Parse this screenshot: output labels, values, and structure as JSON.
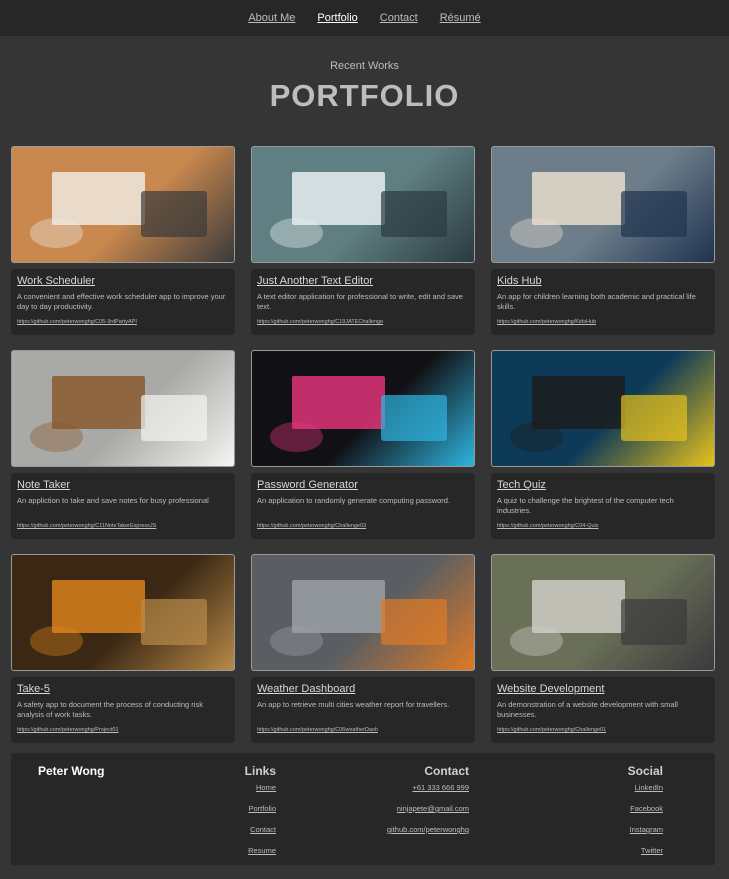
{
  "nav": [
    {
      "label": "About Me",
      "active": false
    },
    {
      "label": "Portfolio",
      "active": true
    },
    {
      "label": "Contact",
      "active": false
    },
    {
      "label": "Résumé",
      "active": false
    }
  ],
  "header": {
    "subtitle": "Recent Works",
    "title": "PORTFOLIO"
  },
  "projects": [
    {
      "title": "Work Scheduler",
      "desc": "A convenient and effective work scheduler app to improve your day to day productivity.",
      "link": "https://github.com/peterwonghg/C05-3rdPartyAPI",
      "colors": [
        "#c9884e",
        "#efe9e0",
        "#3a3a3a"
      ]
    },
    {
      "title": "Just Another Text Editor",
      "desc": "A text editor application for professional to write, edit and save text.",
      "link": "https://github.com/peterwonghg/C19JATEChallenge",
      "colors": [
        "#5f7f82",
        "#e6eef0",
        "#2b3a40"
      ]
    },
    {
      "title": "Kids Hub",
      "desc": "An app for children learning both academic and practical life skills.",
      "link": "https://github.com/peterwonghg/KidsHub",
      "colors": [
        "#6d7e8a",
        "#e8dccd",
        "#1f3350"
      ]
    },
    {
      "title": "Note Taker",
      "desc": "An appliction to take and save notes for busy professional",
      "link": "https://github.com/peterwonghg/C11NoteTakerExpressJS",
      "colors": [
        "#a9a9a7",
        "#8a5a2f",
        "#f4f4f2"
      ]
    },
    {
      "title": "Password Generator",
      "desc": "An application to randomly generate computing password.",
      "link": "https://github.com/peterwonghg/Challenge03",
      "colors": [
        "#111014",
        "#e0357a",
        "#2fb5e0"
      ]
    },
    {
      "title": "Tech Quiz",
      "desc": "A quiz to challenge the brightest of the computer tech industries.",
      "link": "https://github.com/peterwonghg/C04-Quiz",
      "colors": [
        "#0d3a56",
        "#1d1d1d",
        "#e8c21c"
      ]
    },
    {
      "title": "Take-5",
      "desc": "A safety app to document the process of conducting risk analysis of work tasks.",
      "link": "https://github.com/peterwonghg/Project01",
      "colors": [
        "#3a2714",
        "#d9811c",
        "#b88a48"
      ]
    },
    {
      "title": "Weather Dashboard",
      "desc": "An app to retrieve multi cities weather report for travellers.",
      "link": "https://github.com/peterwonghg/C06weatherDash",
      "colors": [
        "#5a5e62",
        "#9aa0a4",
        "#e07a25"
      ]
    },
    {
      "title": "Website Development",
      "desc": "An demonstration of a website development with small businesses.",
      "link": "https://github.com/peterwonghg/Challenge01",
      "colors": [
        "#6a7058",
        "#cfcdc6",
        "#3a3a3c"
      ]
    }
  ],
  "footer": {
    "name": "Peter Wong",
    "links": {
      "heading": "Links",
      "items": [
        "Home",
        "Portfolio",
        "Contact",
        "Resume"
      ]
    },
    "contact": {
      "heading": "Contact",
      "items": [
        "+61 333 666 999",
        "ninjapete@gmail.com",
        "github.com/peterwonghg"
      ]
    },
    "social": {
      "heading": "Social",
      "items": [
        "LinkedIn",
        "Facebook",
        "Instagram",
        "Twitter"
      ]
    }
  }
}
